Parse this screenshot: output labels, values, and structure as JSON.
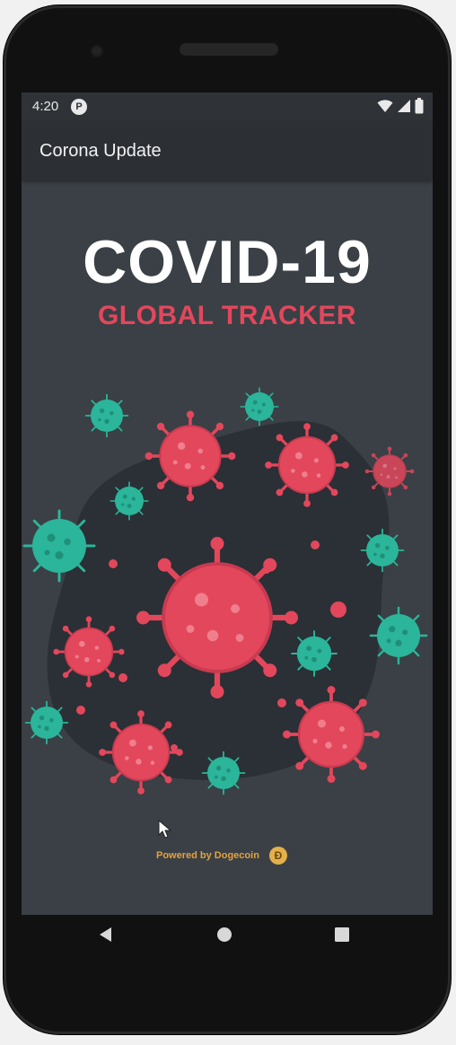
{
  "status_bar": {
    "time": "4:20",
    "app_icon": "P",
    "icons": [
      "wifi-icon",
      "signal-icon",
      "battery-icon"
    ]
  },
  "app_bar": {
    "title": "Corona Update"
  },
  "splash": {
    "title": "COVID-19",
    "subtitle": "GLOBAL TRACKER",
    "powered_by": "Powered by Dogecoin",
    "coin_glyph": "Ð"
  },
  "navigation": {
    "buttons": [
      "back-icon",
      "home-icon",
      "recent-apps-icon"
    ]
  },
  "colors": {
    "screen_background": "#3a4045",
    "app_bar": "#2c3035",
    "virus_red": "#e3475c",
    "virus_teal": "#2bb59a",
    "blob": "#2a3035",
    "powered_text": "#e6a23c"
  }
}
